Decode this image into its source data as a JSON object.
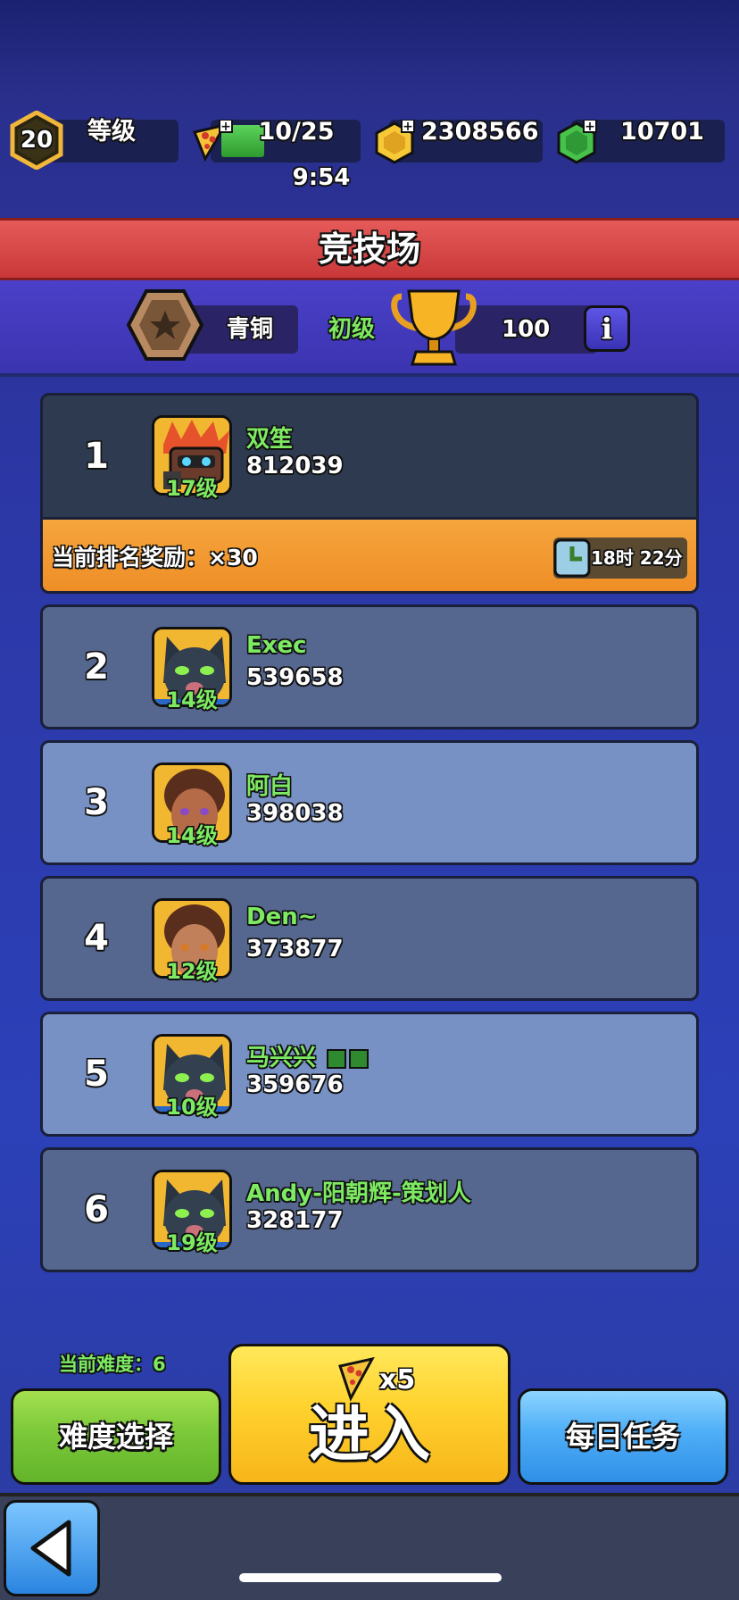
{
  "top_bar": {
    "level": "20",
    "level_label": "等级",
    "energy": "10/25",
    "energy_fill_fraction": 0.4,
    "energy_timer": "9:54",
    "coins": "2308566",
    "gems": "10701"
  },
  "header": {
    "title": "竞技场"
  },
  "rank_info": {
    "tier": "青铜",
    "sub_tier": "初级",
    "trophies": "100",
    "info_icon": "i"
  },
  "leaderboard": [
    {
      "rank": "1",
      "name": "双笙",
      "score": "812039",
      "level": "17级",
      "avatar": "robot-hero"
    },
    {
      "rank": "2",
      "name": "Exec",
      "score": "539658",
      "level": "14级",
      "avatar": "panther-hero"
    },
    {
      "rank": "3",
      "name": "阿白",
      "score": "398038",
      "level": "14级",
      "avatar": "girl-hero"
    },
    {
      "rank": "4",
      "name": "Den~",
      "score": "373877",
      "level": "12级",
      "avatar": "girl-hero"
    },
    {
      "rank": "5",
      "name": "马兴兴",
      "score": "359676",
      "level": "10级",
      "avatar": "panther-hero"
    },
    {
      "rank": "6",
      "name": "Andy-阳朝辉-策划人",
      "score": "328177",
      "level": "19级",
      "avatar": "panther-hero"
    }
  ],
  "reward": {
    "text": "当前排名奖励：×30",
    "timer": "18时 22分"
  },
  "bottom": {
    "difficulty_label": "当前难度：6",
    "difficulty_button": "难度选择",
    "enter_cost": "x5",
    "enter_button": "进入",
    "daily_button": "每日任务"
  },
  "colors": {
    "accent_green": "#7dea62",
    "banner_red": "#d94646",
    "reward_orange": "#f39a30"
  }
}
